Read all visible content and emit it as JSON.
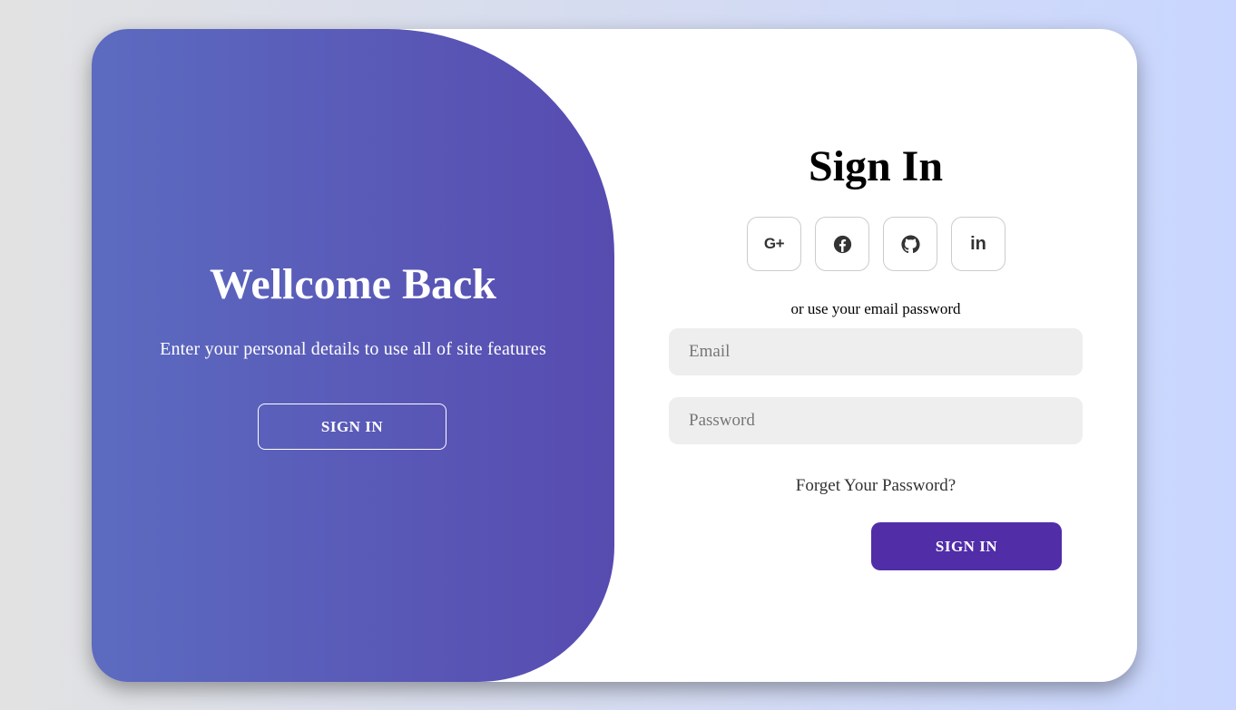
{
  "toggle": {
    "title": "Wellcome Back",
    "text": "Enter your personal details to use all of site features",
    "button_label": "SIGN IN"
  },
  "form": {
    "title": "Sign In",
    "social": [
      {
        "icon": "google-plus-icon",
        "glyph": "G+"
      },
      {
        "icon": "facebook-icon"
      },
      {
        "icon": "github-icon"
      },
      {
        "icon": "linkedin-icon",
        "glyph": "in"
      }
    ],
    "alt_text": "or use your email password",
    "email_placeholder": "Email",
    "password_placeholder": "Password",
    "forgot_label": "Forget Your Password?",
    "submit_label": "SIGN IN"
  },
  "colors": {
    "background_gradient": [
      "#e2e2e2",
      "#c9d6ff"
    ],
    "panel_gradient": [
      "#5c6bc0",
      "#574bb0"
    ],
    "primary_button": "#512da8",
    "input_background": "#eeeeee"
  }
}
